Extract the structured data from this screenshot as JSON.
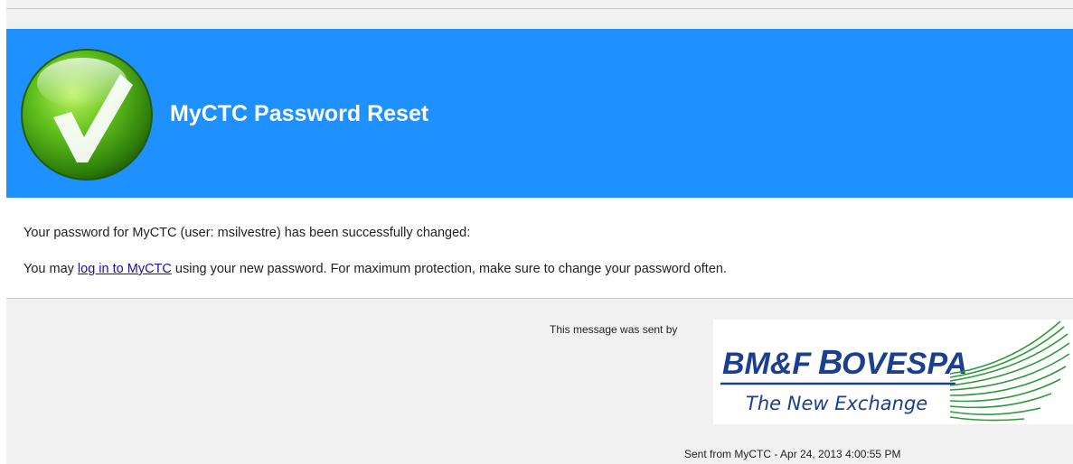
{
  "banner": {
    "title": "MyCTC Password Reset",
    "background_color": "#1e90ff",
    "icon": "green-check-icon"
  },
  "message": {
    "line1": "Your password for MyCTC (user: msilvestre) has been successfully changed:",
    "line2_prefix": "You may ",
    "login_link": "log in to MyCTC",
    "line2_suffix": " using your new password. For maximum protection, make sure to change your password often."
  },
  "footer": {
    "sent_by": "This message was sent by",
    "logo_brand": "BM&FBOVESPA",
    "logo_tagline": "The New Exchange",
    "sent_from": "Sent from MyCTC - Apr 24, 2013 4:00:55 PM"
  }
}
